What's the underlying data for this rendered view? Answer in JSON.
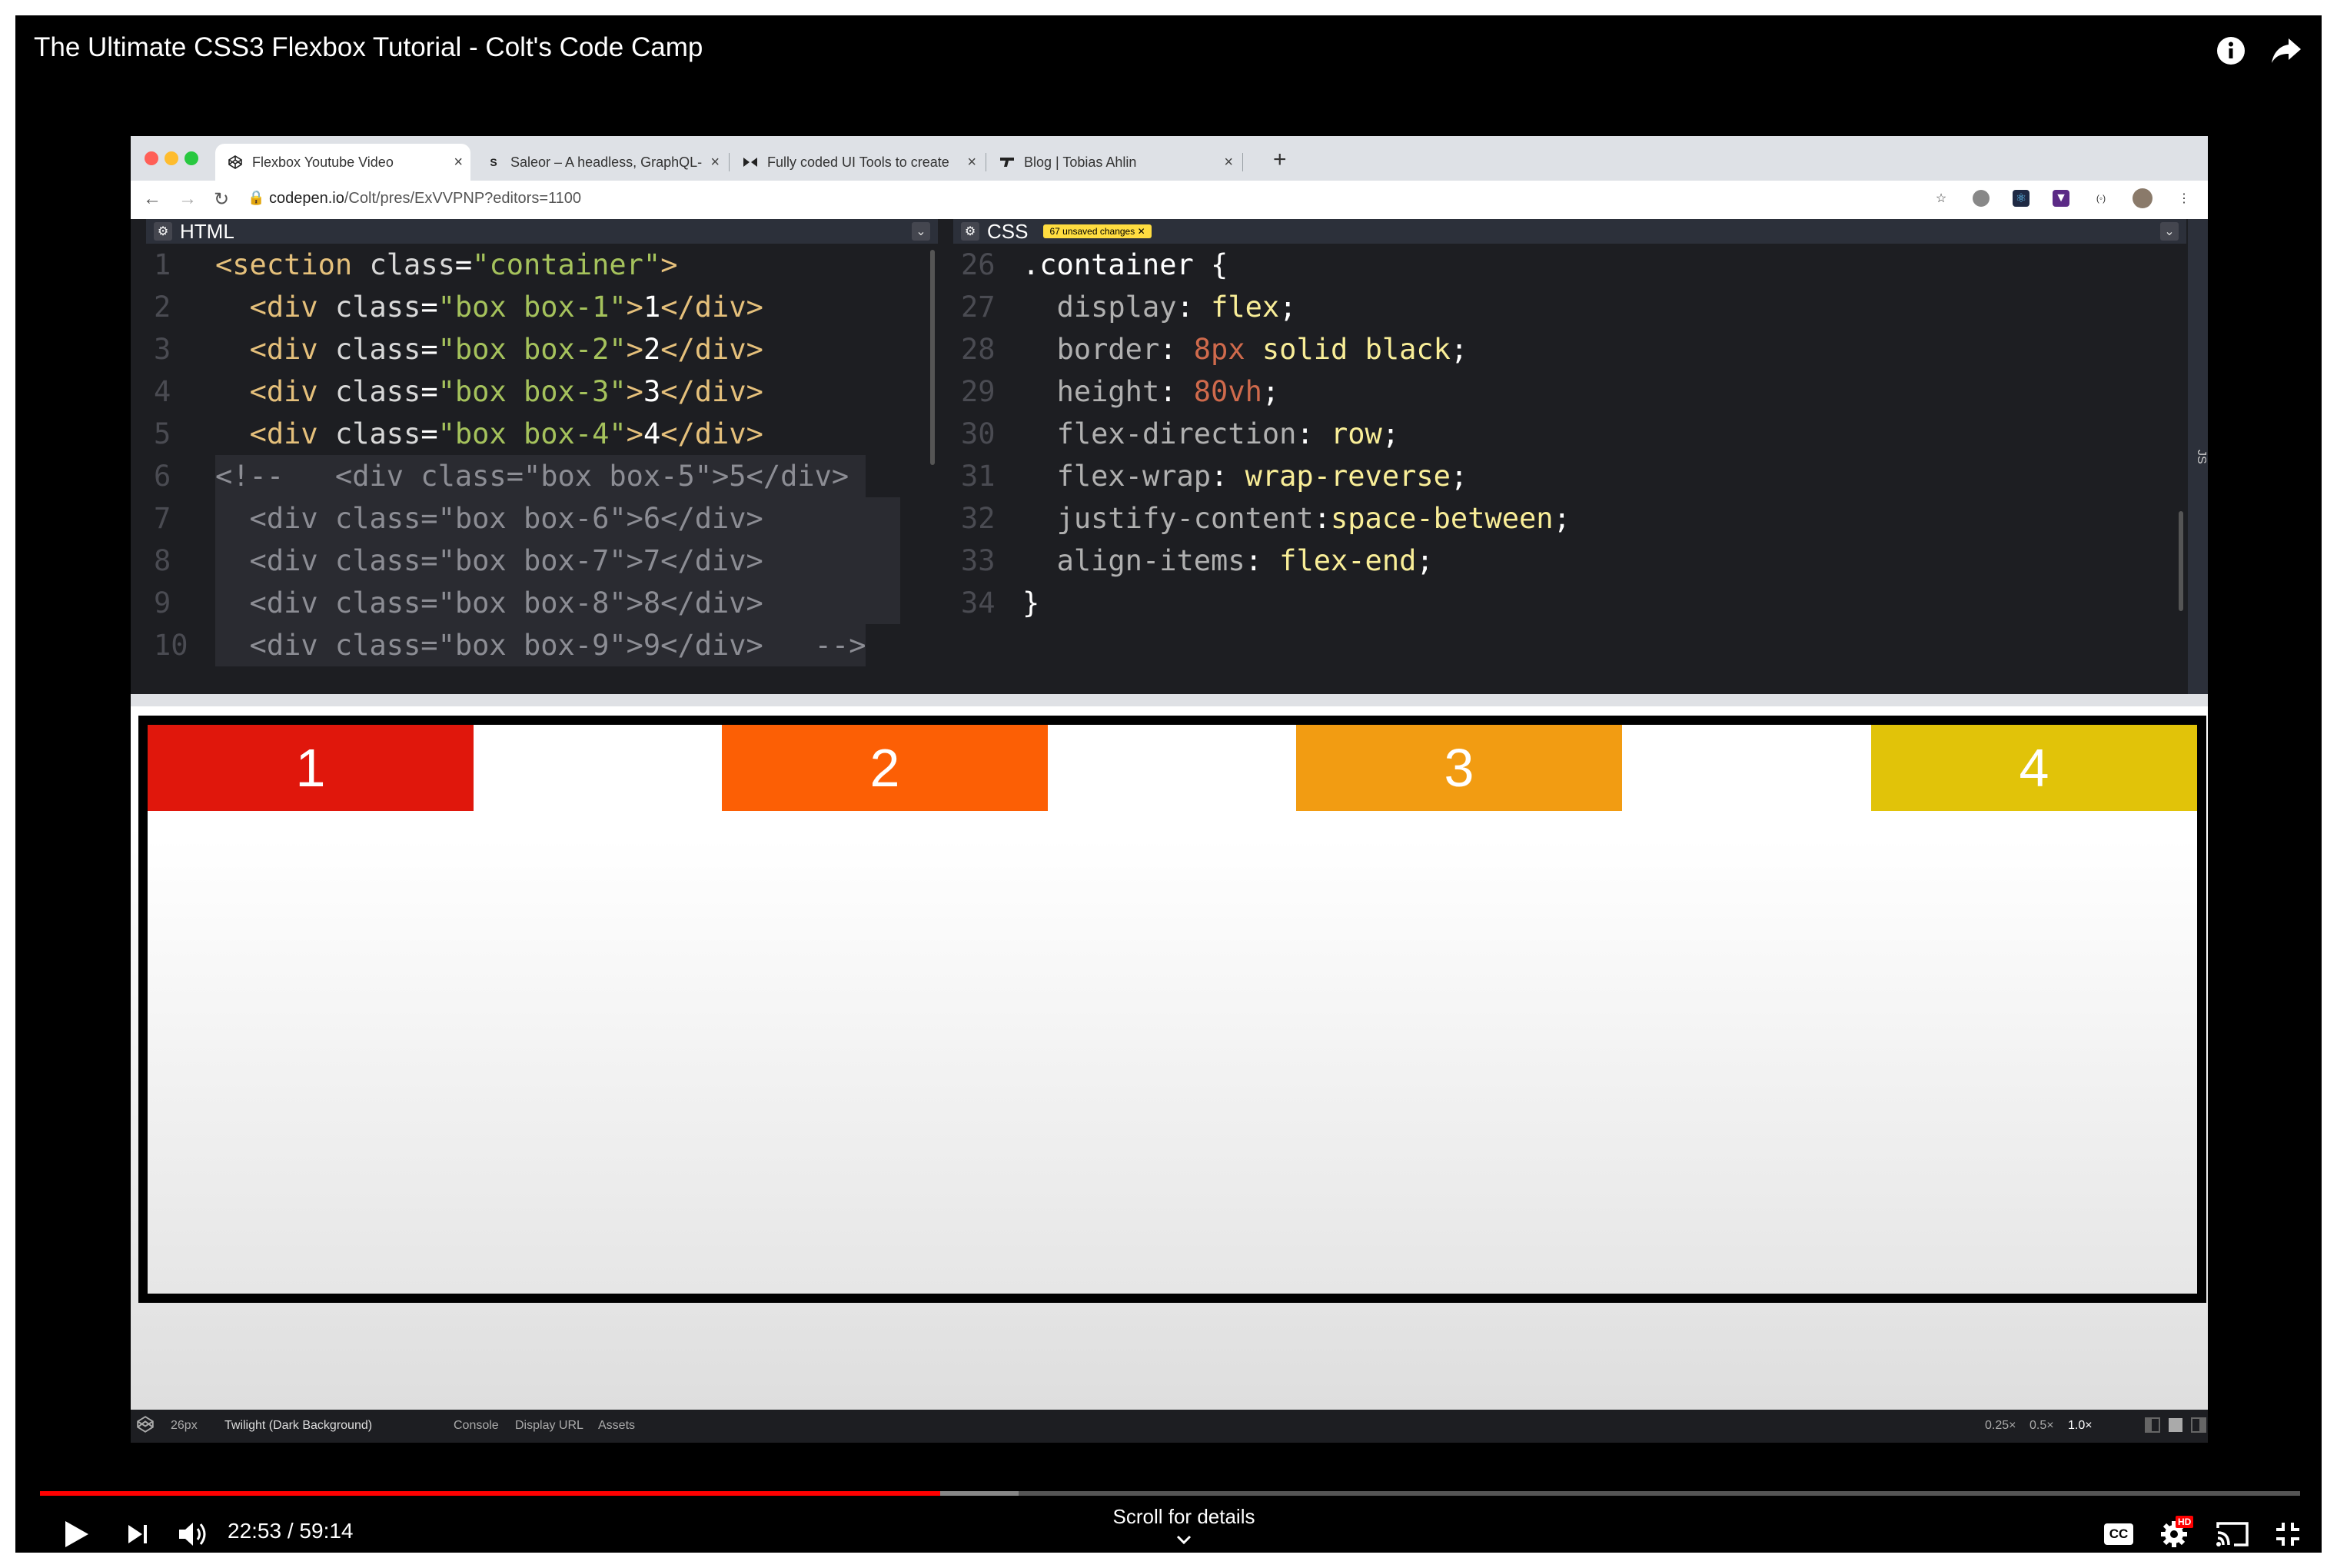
{
  "video": {
    "title": "The Ultimate CSS3 Flexbox Tutorial - Colt's Code Camp",
    "time_current": "22:53",
    "time_sep": " / ",
    "time_total": "59:14",
    "scroll_hint": "Scroll for details",
    "hd_badge": "HD",
    "cc_label": "CC",
    "progress_played_fraction": 0.3984,
    "progress_loaded_fraction": 0.433
  },
  "browser": {
    "tabs": [
      {
        "label": "Flexbox Youtube Video",
        "favicon": "codepen-icon",
        "active": true
      },
      {
        "label": "Saleor – A headless, GraphQL-",
        "favicon": "S",
        "active": false
      },
      {
        "label": "Fully coded UI Tools to create",
        "favicon": "bowtie-icon",
        "active": false
      },
      {
        "label": "Blog | Tobias Ahlin",
        "favicon": "ta-icon",
        "active": false
      }
    ],
    "url_host": "codepen.io",
    "url_path": "/Colt/pres/ExVVPNP?editors=1100"
  },
  "editor": {
    "html_title": "HTML",
    "css_title": "CSS",
    "unsaved_badge": "67 unsaved changes",
    "js_strip": "JS",
    "html_line_numbers": [
      "1",
      "2",
      "3",
      "4",
      "5",
      "6",
      "7",
      "8",
      "9",
      "10"
    ],
    "css_line_numbers": [
      "26",
      "27",
      "28",
      "29",
      "30",
      "31",
      "32",
      "33",
      "34"
    ]
  },
  "result": {
    "boxes": [
      {
        "label": "1",
        "color": "#e0170c"
      },
      {
        "label": "2",
        "color": "#fc5f05"
      },
      {
        "label": "3",
        "color": "#f29c12"
      },
      {
        "label": "4",
        "color": "#e1c309"
      }
    ]
  },
  "statusbar": {
    "font_size": "26px",
    "theme": "Twilight (Dark Background)",
    "console": "Console",
    "display_url": "Display URL",
    "assets": "Assets",
    "zoom_025": "0.25×",
    "zoom_05": "0.5×",
    "zoom_1": "1.0×"
  },
  "colors": {
    "progress_red": "#ff0000",
    "editor_bg": "#1d1e22",
    "badge_yellow": "#ffdd40"
  }
}
